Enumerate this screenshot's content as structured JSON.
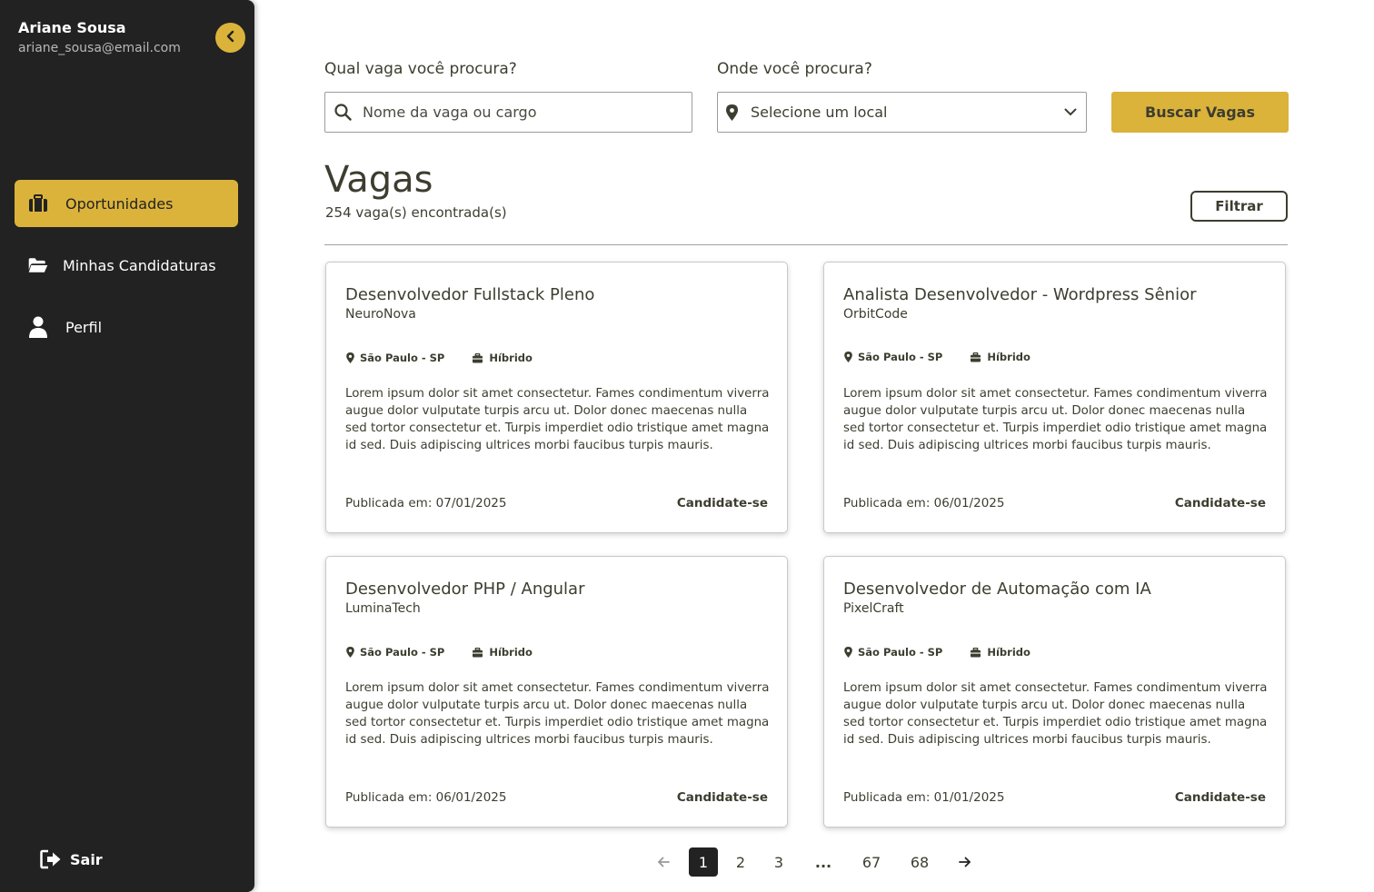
{
  "user": {
    "name": "Ariane Sousa",
    "email": "ariane_sousa@email.com"
  },
  "sidebar": {
    "items": [
      {
        "label": "Oportunidades",
        "icon": "briefcase-icon",
        "active": true
      },
      {
        "label": "Minhas Candidaturas",
        "icon": "folder-open-icon",
        "active": false
      },
      {
        "label": "Perfil",
        "icon": "user-icon",
        "active": false
      }
    ],
    "logout_label": "Sair"
  },
  "search": {
    "job_label": "Qual vaga você procura?",
    "job_placeholder": "Nome da vaga ou cargo",
    "location_label": "Onde você procura?",
    "location_value": "Selecione um local",
    "button_label": "Buscar Vagas"
  },
  "listing": {
    "title": "Vagas",
    "count_text": "254 vaga(s) encontrada(s)",
    "filter_label": "Filtrar"
  },
  "jobs": [
    {
      "title": "Desenvolvedor Fullstack Pleno",
      "company": "NeuroNova",
      "location": "São Paulo - SP",
      "mode": "Híbrido",
      "description": "Lorem ipsum dolor sit amet consectetur. Fames condimentum viverra augue dolor vulputate turpis arcu ut. Dolor donec maecenas nulla sed tortor consectetur et. Turpis imperdiet odio tristique amet magna id sed. Duis adipiscing ultrices morbi faucibus turpis mauris.",
      "published": "Publicada em: 07/01/2025",
      "apply_label": "Candidate-se"
    },
    {
      "title": "Analista Desenvolvedor - Wordpress Sênior",
      "company": "OrbitCode",
      "location": "São Paulo - SP",
      "mode": "Híbrido",
      "description": "Lorem ipsum dolor sit amet consectetur. Fames condimentum viverra augue dolor vulputate turpis arcu ut. Dolor donec maecenas nulla sed tortor consectetur et. Turpis imperdiet odio tristique amet magna id sed. Duis adipiscing ultrices morbi faucibus turpis mauris.",
      "published": "Publicada em: 06/01/2025",
      "apply_label": "Candidate-se"
    },
    {
      "title": "Desenvolvedor PHP / Angular",
      "company": "LuminaTech",
      "location": "São Paulo - SP",
      "mode": "Híbrido",
      "description": "Lorem ipsum dolor sit amet consectetur. Fames condimentum viverra augue dolor vulputate turpis arcu ut. Dolor donec maecenas nulla sed tortor consectetur et. Turpis imperdiet odio tristique amet magna id sed. Duis adipiscing ultrices morbi faucibus turpis mauris.",
      "published": "Publicada em: 06/01/2025",
      "apply_label": "Candidate-se"
    },
    {
      "title": "Desenvolvedor de Automação com IA",
      "company": "PixelCraft",
      "location": "São Paulo - SP",
      "mode": "Híbrido",
      "description": "Lorem ipsum dolor sit amet consectetur. Fames condimentum viverra augue dolor vulputate turpis arcu ut. Dolor donec maecenas nulla sed tortor consectetur et. Turpis imperdiet odio tristique amet magna id sed. Duis adipiscing ultrices morbi faucibus turpis mauris.",
      "published": "Publicada em: 01/01/2025",
      "apply_label": "Candidate-se"
    }
  ],
  "pagination": {
    "prev_icon": "arrow-left-icon",
    "pages": [
      "1",
      "2",
      "3",
      "...",
      "67",
      "68"
    ],
    "current": "1",
    "next_icon": "arrow-right-icon"
  },
  "colors": {
    "accent": "#dbb33b",
    "sidebar": "#222222",
    "text": "#3d3d30"
  }
}
